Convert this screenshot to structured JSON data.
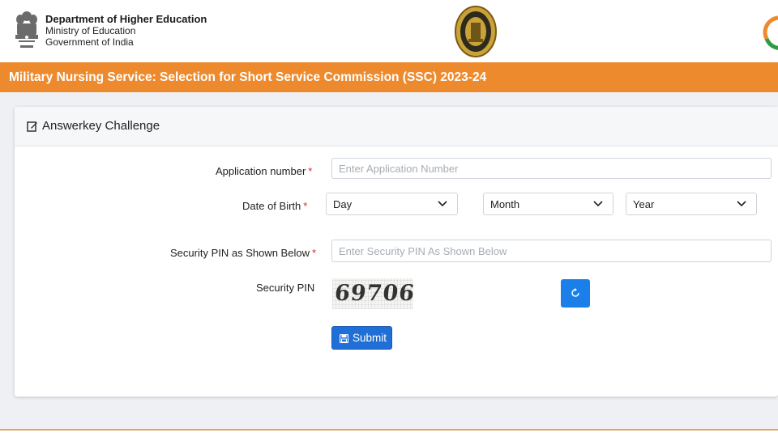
{
  "header": {
    "dept_title": "Department of Higher Education",
    "ministry": "Ministry of Education",
    "government": "Government of India",
    "emblem_icon": "ashoka-emblem-icon",
    "seal_icon": "nta-seal-icon",
    "brand_logo_icon": "tricolor-logo-icon"
  },
  "title_bar": {
    "text": "Military Nursing Service: Selection for Short Service Commission (SSC) 2023-24",
    "color": "#ee8a2e"
  },
  "form": {
    "card_title": "Answerkey Challenge",
    "application_label": "Application number",
    "application_placeholder": "Enter Application Number",
    "dob_label": "Date of Birth",
    "day_value": "Day",
    "month_value": "Month",
    "year_value": "Year",
    "pin_label": "Security PIN as Shown Below",
    "pin_placeholder": "Enter Security PIN As Shown Below",
    "captcha_label": "Security PIN",
    "captcha_value": "69706",
    "submit_label": "Submit",
    "required_mark": "*",
    "accent_color": "#1f6fd6"
  }
}
